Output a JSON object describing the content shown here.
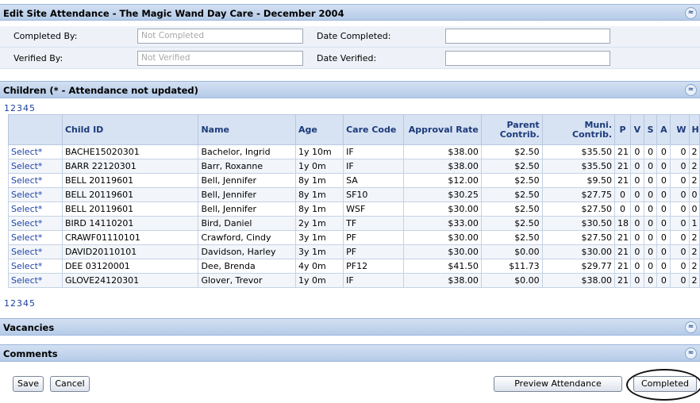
{
  "title_bar": {
    "title": "Edit Site Attendance - The Magic Wand Day Care - December 2004",
    "collapse_glyph": "≈"
  },
  "form": {
    "completed_by_label": "Completed By:",
    "completed_by_value": "Not Completed",
    "date_completed_label": "Date Completed:",
    "date_completed_value": "",
    "verified_by_label": "Verified By:",
    "verified_by_value": "Not Verified",
    "date_verified_label": "Date Verified:",
    "date_verified_value": ""
  },
  "children": {
    "header": "Children (* - Attendance not updated)",
    "pager_top": "12345",
    "pager_bottom": "12345",
    "columns": [
      "",
      "Child ID",
      "Name",
      "Age",
      "Care Code",
      "Approval Rate",
      "Parent Contrib.",
      "Muni. Contrib.",
      "P",
      "V",
      "S",
      "A",
      "W",
      "H"
    ],
    "rows": [
      [
        "Select*",
        "BACHE15020301",
        "Bachelor, Ingrid",
        "1y 10m",
        "IF",
        "$38.00",
        "$2.50",
        "$35.50",
        "21",
        "0",
        "0",
        "0",
        "0",
        "2"
      ],
      [
        "Select*",
        "BARR 22120301",
        "Barr, Roxanne",
        "1y 0m",
        "IF",
        "$38.00",
        "$2.50",
        "$35.50",
        "21",
        "0",
        "0",
        "0",
        "0",
        "2"
      ],
      [
        "Select*",
        "BELL 20119601",
        "Bell, Jennifer",
        "8y 1m",
        "SA",
        "$12.00",
        "$2.50",
        "$9.50",
        "21",
        "0",
        "0",
        "0",
        "0",
        "2"
      ],
      [
        "Select*",
        "BELL 20119601",
        "Bell, Jennifer",
        "8y 1m",
        "SF10",
        "$30.25",
        "$2.50",
        "$27.75",
        "0",
        "0",
        "0",
        "0",
        "0",
        "0"
      ],
      [
        "Select*",
        "BELL 20119601",
        "Bell, Jennifer",
        "8y 1m",
        "WSF",
        "$30.00",
        "$2.50",
        "$27.50",
        "0",
        "0",
        "0",
        "0",
        "0",
        "0"
      ],
      [
        "Select*",
        "BIRD 14110201",
        "Bird, Daniel",
        "2y 1m",
        "TF",
        "$33.00",
        "$2.50",
        "$30.50",
        "18",
        "0",
        "0",
        "0",
        "0",
        "1"
      ],
      [
        "Select*",
        "CRAWF01110101",
        "Crawford, Cindy",
        "3y 1m",
        "PF",
        "$30.00",
        "$2.50",
        "$27.50",
        "21",
        "0",
        "0",
        "0",
        "0",
        "2"
      ],
      [
        "Select*",
        "DAVID20110101",
        "Davidson, Harley",
        "3y 1m",
        "PF",
        "$30.00",
        "$0.00",
        "$30.00",
        "21",
        "0",
        "0",
        "0",
        "0",
        "2"
      ],
      [
        "Select*",
        "DEE 03120001",
        "Dee, Brenda",
        "4y 0m",
        "PF12",
        "$41.50",
        "$11.73",
        "$29.77",
        "21",
        "0",
        "0",
        "0",
        "0",
        "2"
      ],
      [
        "Select*",
        "GLOVE24120301",
        "Glover, Trevor",
        "1y 0m",
        "IF",
        "$38.00",
        "$0.00",
        "$38.00",
        "21",
        "0",
        "0",
        "0",
        "0",
        "2"
      ]
    ]
  },
  "vacancies": {
    "header": "Vacancies",
    "expand_glyph": "≈"
  },
  "comments": {
    "header": "Comments",
    "expand_glyph": "≈"
  },
  "buttons": {
    "save": "Save",
    "cancel": "Cancel",
    "preview": "Preview Attendance",
    "completed": "Completed"
  }
}
